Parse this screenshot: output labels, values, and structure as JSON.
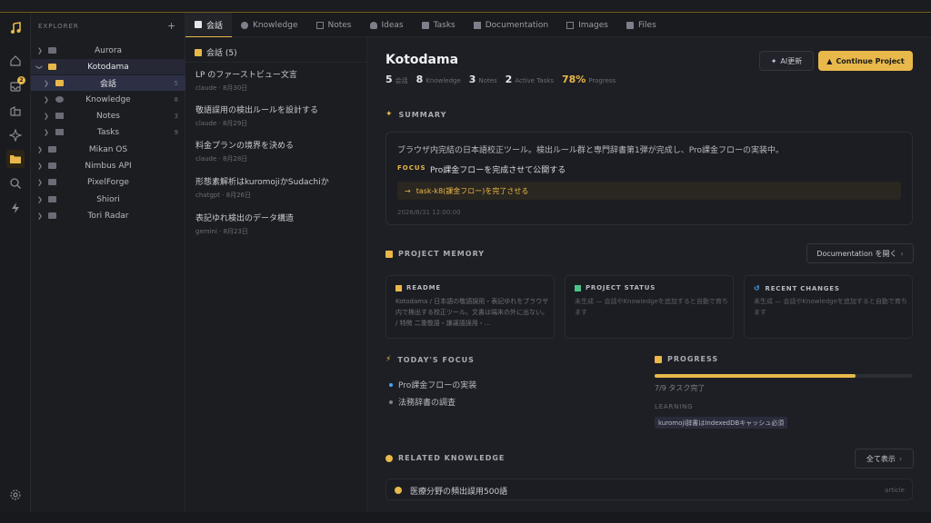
{
  "explorer": {
    "title": "EXPLORER",
    "add": "+",
    "tree": [
      {
        "label": "Aurora",
        "count": ""
      },
      {
        "label": "Kotodama",
        "count": ""
      },
      {
        "label": "会話",
        "count": "5"
      },
      {
        "label": "Knowledge",
        "count": "8"
      },
      {
        "label": "Notes",
        "count": "3"
      },
      {
        "label": "Tasks",
        "count": "9"
      },
      {
        "label": "Mikan OS",
        "count": ""
      },
      {
        "label": "Nimbus API",
        "count": ""
      },
      {
        "label": "PixelForge",
        "count": ""
      },
      {
        "label": "Shiori",
        "count": ""
      },
      {
        "label": "Tori Radar",
        "count": ""
      }
    ]
  },
  "activity": {
    "inbox_badge": "2"
  },
  "tabs": [
    "会話",
    "Knowledge",
    "Notes",
    "Ideas",
    "Tasks",
    "Documentation",
    "Images",
    "Files"
  ],
  "conversations": {
    "header": "会話 (5)",
    "items": [
      {
        "title": "LP のファーストビュー文言",
        "meta": "claude · 8月30日"
      },
      {
        "title": "敬語誤用の検出ルールを設計する",
        "meta": "claude · 8月29日"
      },
      {
        "title": "料金プランの境界を決める",
        "meta": "claude · 8月28日"
      },
      {
        "title": "形態素解析はkuromojiかSudachiか",
        "meta": "chatgpt · 8月26日"
      },
      {
        "title": "表記ゆれ検出のデータ構造",
        "meta": "gemini · 8月23日"
      }
    ]
  },
  "project": {
    "title": "Kotodama",
    "stats": [
      {
        "num": "5",
        "label": "会話"
      },
      {
        "num": "8",
        "label": "Knowledge"
      },
      {
        "num": "3",
        "label": "Notes"
      },
      {
        "num": "2",
        "label": "Active Tasks"
      },
      {
        "num": "78%",
        "label": "Progress"
      }
    ],
    "ai_button": "AI更新",
    "continue_button": "Continue Project"
  },
  "summary": {
    "heading": "SUMMARY",
    "text": "ブラウザ内完結の日本語校正ツール。検出ルール群と専門辞書第1弾が完成し、Pro課金フローの実装中。",
    "focus_label": "FOCUS",
    "focus_text": "Pro課金フローを完成させて公開する",
    "next_action": "task-k8(課金フロー)を完了させる",
    "timestamp": "2026/8/31 12:00:00"
  },
  "memory": {
    "heading": "PROJECT MEMORY",
    "doc_button": "Documentation を開く",
    "cards": [
      {
        "title": "README",
        "body": "Kotodama / 日本語の敬語誤用・表記ゆれをブラウザ内で検出する校正ツール。文書は端末の外に出ない。 / 特徴 二重敬語・謙譲語誤用・..."
      },
      {
        "title": "PROJECT STATUS",
        "body": "未生成 — 会話やKnowledgeを追加すると自動で育ちます"
      },
      {
        "title": "RECENT CHANGES",
        "body": "未生成 — 会話やKnowledgeを追加すると自動で育ちます"
      }
    ]
  },
  "today": {
    "heading": "TODAY'S FOCUS",
    "items": [
      {
        "text": "Pro課金フローの実装",
        "color": "#4aa3f0"
      },
      {
        "text": "法務辞書の調査",
        "color": "#7d808a"
      }
    ]
  },
  "progress": {
    "heading": "PROGRESS",
    "done": 7,
    "total": 9,
    "text": "7/9 タスク完了",
    "learning_label": "LEARNING",
    "learning_chip": "kuromoji辞書はIndexedDBキャッシュ必須"
  },
  "related": {
    "heading": "RELATED KNOWLEDGE",
    "all_button": "全て表示",
    "items": [
      {
        "title": "医療分野の頻出誤用500語",
        "type": "article"
      }
    ]
  },
  "colors": {
    "accent": "#e8b84a",
    "bg": "#1e1f24",
    "blue": "#4aa3f0"
  }
}
